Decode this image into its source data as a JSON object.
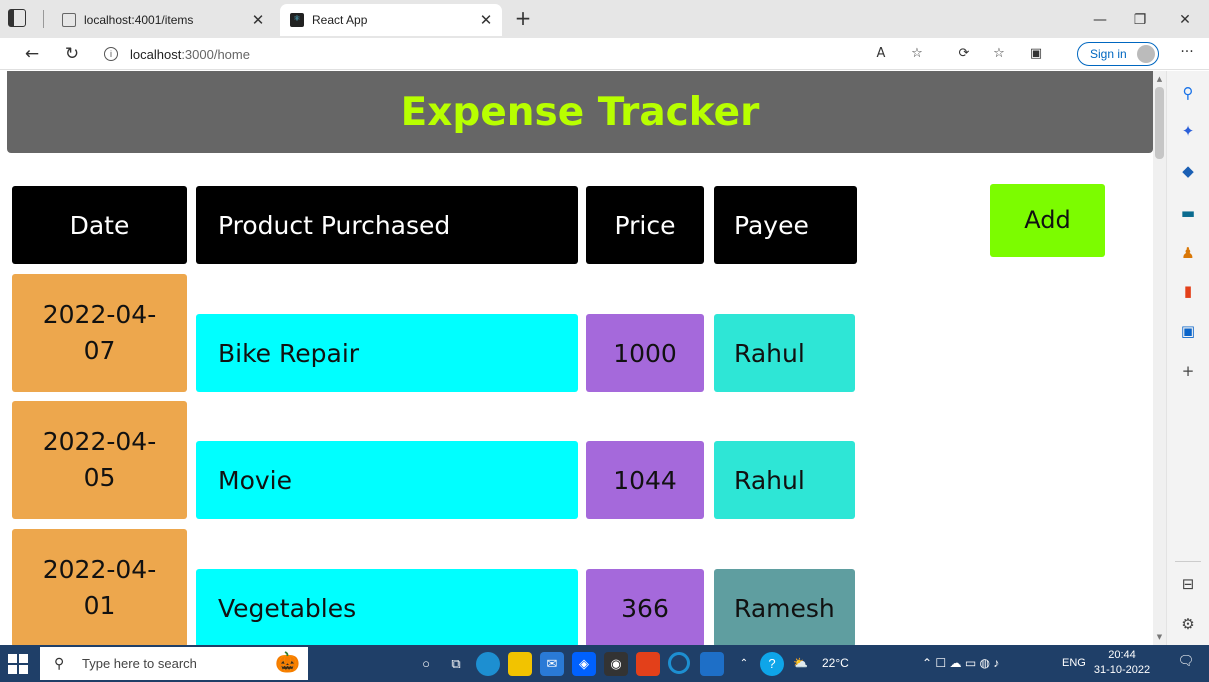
{
  "browser": {
    "tabs": [
      {
        "title": "localhost:4001/items",
        "active": false
      },
      {
        "title": "React App",
        "active": true
      }
    ],
    "url_host": "localhost",
    "url_rest": ":3000/home",
    "sign_in_label": "Sign in"
  },
  "app": {
    "title": "Expense Tracker",
    "title_color": "#b8ff00",
    "header_bg": "#666666",
    "columns": [
      "Date",
      "Product Purchased",
      "Price",
      "Payee"
    ],
    "add_label": "Add",
    "rows": [
      {
        "date_line1": "2022-04-",
        "date_line2": "07",
        "product": "Bike Repair",
        "price": "1000",
        "payee": "Rahul",
        "payee_color": "#2ee6d6"
      },
      {
        "date_line1": "2022-04-",
        "date_line2": "05",
        "product": "Movie",
        "price": "1044",
        "payee": "Rahul",
        "payee_color": "#2ee6d6"
      },
      {
        "date_line1": "2022-04-",
        "date_line2": "01",
        "product": "Vegetables",
        "price": "366",
        "payee": "Ramesh",
        "payee_color": "#5f9ea0"
      }
    ],
    "colors": {
      "date": "#eda74d",
      "product": "#00ffff",
      "price": "#a569db",
      "add": "#7cfc00"
    }
  },
  "taskbar": {
    "search_placeholder": "Type here to search",
    "weather": "22°C",
    "language": "ENG",
    "time": "20:44",
    "date": "31-10-2022"
  }
}
